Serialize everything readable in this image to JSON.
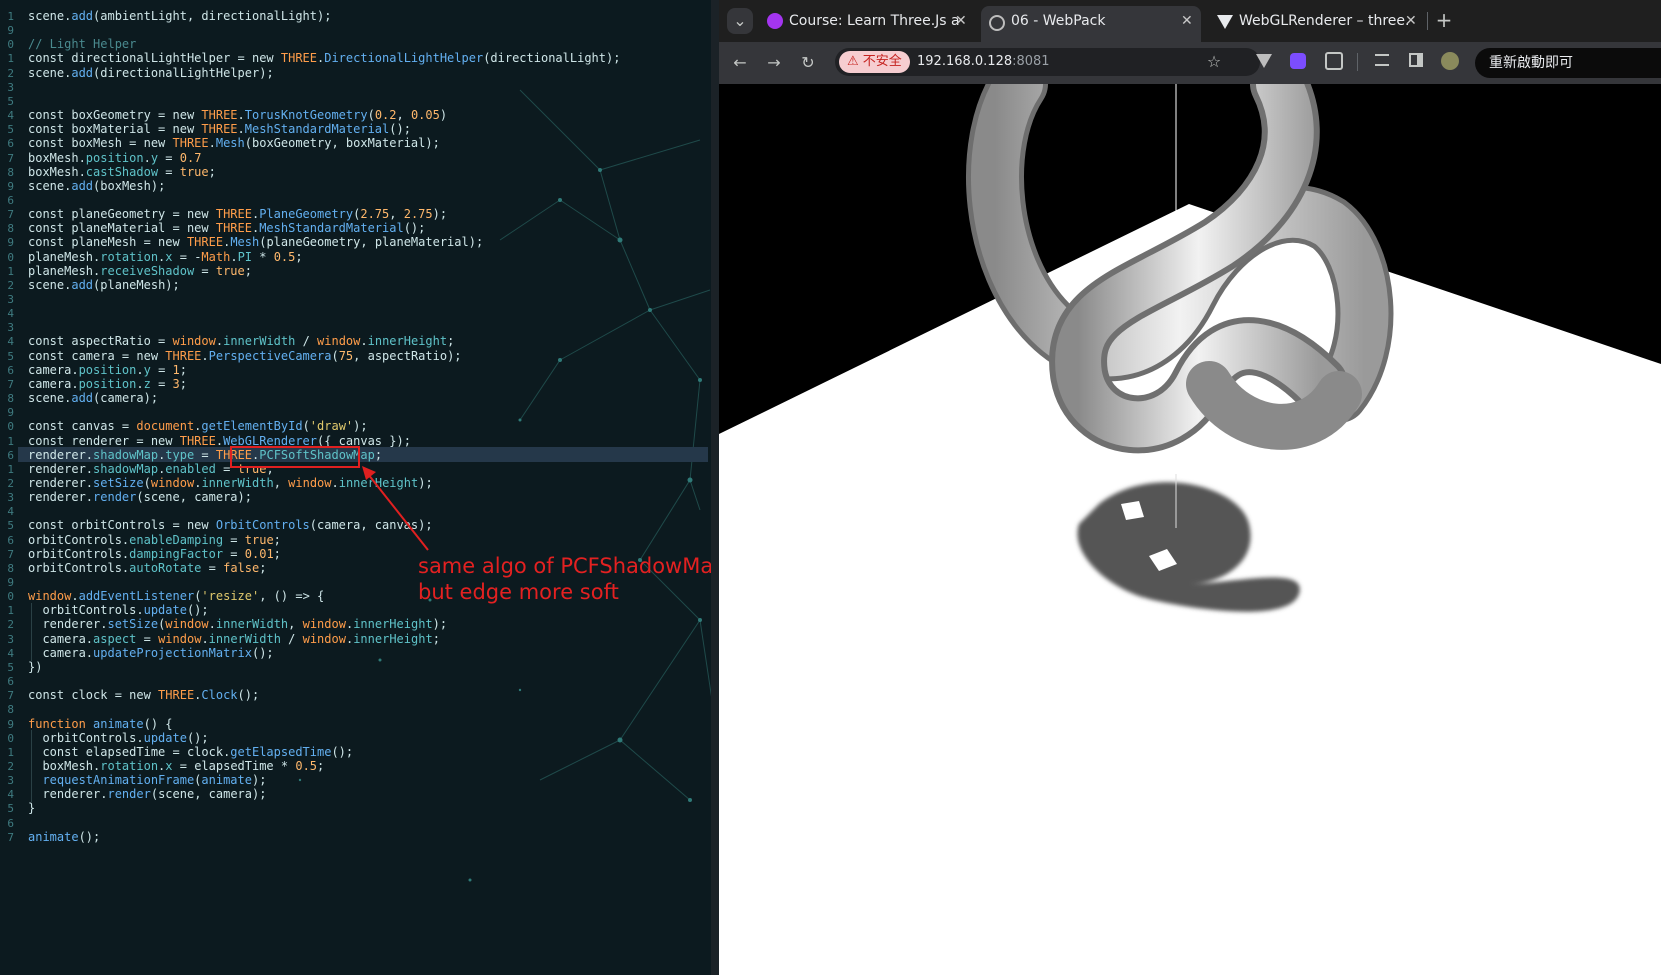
{
  "editor": {
    "lines": [
      {
        "num": "1",
        "html": "scene.<span class='f'>add</span>(ambientLight, directionalLight);"
      },
      {
        "num": "9",
        "html": ""
      },
      {
        "num": "0",
        "html": "<span class='c'>// Light Helper</span>"
      },
      {
        "num": "1",
        "html": "const directionalLightHelper = new <span class='t'>THREE</span>.<span class='f'>DirectionalLightHelper</span>(directionalLight);"
      },
      {
        "num": "2",
        "html": "scene.<span class='f'>add</span>(directionalLightHelper);"
      },
      {
        "num": "3",
        "html": ""
      },
      {
        "num": "5",
        "html": ""
      },
      {
        "num": "4",
        "html": "const boxGeometry = new <span class='t'>THREE</span>.<span class='f'>TorusKnotGeometry</span>(<span class='n'>0.2</span>, <span class='n'>0.05</span>)"
      },
      {
        "num": "5",
        "html": "const boxMaterial = new <span class='t'>THREE</span>.<span class='f'>MeshStandardMaterial</span>();"
      },
      {
        "num": "6",
        "html": "const boxMesh = new <span class='t'>THREE</span>.<span class='f'>Mesh</span>(boxGeometry, boxMaterial);"
      },
      {
        "num": "7",
        "html": "boxMesh.<span class='p'>position</span>.<span class='p'>y</span> = <span class='n'>0.7</span>"
      },
      {
        "num": "8",
        "html": "boxMesh.<span class='p'>castShadow</span> = <span class='n'>true</span>;"
      },
      {
        "num": "9",
        "html": "scene.<span class='f'>add</span>(boxMesh);"
      },
      {
        "num": "6",
        "html": ""
      },
      {
        "num": "7",
        "html": "const planeGeometry = new <span class='t'>THREE</span>.<span class='f'>PlaneGeometry</span>(<span class='n'>2.75</span>, <span class='n'>2.75</span>);"
      },
      {
        "num": "8",
        "html": "const planeMaterial = new <span class='t'>THREE</span>.<span class='f'>MeshStandardMaterial</span>();"
      },
      {
        "num": "9",
        "html": "const planeMesh = new <span class='t'>THREE</span>.<span class='f'>Mesh</span>(planeGeometry, planeMaterial);"
      },
      {
        "num": "0",
        "html": "planeMesh.<span class='p'>rotation</span>.<span class='p'>x</span> = -<span class='t'>Math</span>.<span class='p'>PI</span> * <span class='n'>0.5</span>;"
      },
      {
        "num": "1",
        "html": "planeMesh.<span class='p'>receiveShadow</span> = <span class='n'>true</span>;"
      },
      {
        "num": "2",
        "html": "scene.<span class='f'>add</span>(planeMesh);"
      },
      {
        "num": "3",
        "html": ""
      },
      {
        "num": "4",
        "html": ""
      },
      {
        "num": "3",
        "html": ""
      },
      {
        "num": "4",
        "html": "const aspectRatio = <span class='w'>window</span>.<span class='p'>innerWidth</span> / <span class='w'>window</span>.<span class='p'>innerHeight</span>;"
      },
      {
        "num": "5",
        "html": "const camera = new <span class='t'>THREE</span>.<span class='f'>PerspectiveCamera</span>(<span class='n'>75</span>, aspectRatio);"
      },
      {
        "num": "6",
        "html": "camera.<span class='p'>position</span>.<span class='p'>y</span> = <span class='n'>1</span>;"
      },
      {
        "num": "7",
        "html": "camera.<span class='p'>position</span>.<span class='p'>z</span> = <span class='n'>3</span>;"
      },
      {
        "num": "8",
        "html": "scene.<span class='f'>add</span>(camera);"
      },
      {
        "num": "9",
        "html": ""
      },
      {
        "num": "0",
        "html": "const canvas = <span class='w'>document</span>.<span class='f'>getElementById</span>(<span class='s'>'draw'</span>);"
      },
      {
        "num": "1",
        "html": "const renderer = new <span class='t'>THREE</span>.<span class='f'>WebGLRenderer</span>({ canvas });"
      },
      {
        "num": "6",
        "html": "renderer.<span class='p'>shadowMap</span>.<span class='p'>type</span> = <span class='t'>THREE</span>.<span class='p'>PCFSoftShadowMap</span>;"
      },
      {
        "num": "1",
        "html": "renderer.<span class='p'>shadowMap</span>.<span class='p'>enabled</span> = <span class='n'>true</span>;"
      },
      {
        "num": "2",
        "html": "renderer.<span class='f'>setSize</span>(<span class='w'>window</span>.<span class='p'>innerWidth</span>, <span class='w'>window</span>.<span class='p'>innerHeight</span>);"
      },
      {
        "num": "3",
        "html": "renderer.<span class='f'>render</span>(scene, camera);"
      },
      {
        "num": "4",
        "html": ""
      },
      {
        "num": "5",
        "html": "const orbitControls = new <span class='f'>OrbitControls</span>(camera, canvas);"
      },
      {
        "num": "6",
        "html": "orbitControls.<span class='p'>enableDamping</span> = <span class='n'>true</span>;"
      },
      {
        "num": "7",
        "html": "orbitControls.<span class='p'>dampingFactor</span> = <span class='n'>0.01</span>;"
      },
      {
        "num": "8",
        "html": "orbitControls.<span class='p'>autoRotate</span> = <span class='n'>false</span>;"
      },
      {
        "num": "9",
        "html": ""
      },
      {
        "num": "0",
        "html": "<span class='w'>window</span>.<span class='f'>addEventListener</span>(<span class='s'>'resize'</span>, () => {"
      },
      {
        "num": "1",
        "html": "  orbitControls.<span class='f'>update</span>();"
      },
      {
        "num": "2",
        "html": "  renderer.<span class='f'>setSize</span>(<span class='w'>window</span>.<span class='p'>innerWidth</span>, <span class='w'>window</span>.<span class='p'>innerHeight</span>);"
      },
      {
        "num": "3",
        "html": "  camera.<span class='p'>aspect</span> = <span class='w'>window</span>.<span class='p'>innerWidth</span> / <span class='w'>window</span>.<span class='p'>innerHeight</span>;"
      },
      {
        "num": "4",
        "html": "  camera.<span class='f'>updateProjectionMatrix</span>();"
      },
      {
        "num": "5",
        "html": "})"
      },
      {
        "num": "6",
        "html": ""
      },
      {
        "num": "7",
        "html": "const clock = new <span class='t'>THREE</span>.<span class='f'>Clock</span>();"
      },
      {
        "num": "8",
        "html": ""
      },
      {
        "num": "9",
        "html": "<span class='w'>function</span> <span class='f'>animate</span>() {"
      },
      {
        "num": "0",
        "html": "  orbitControls.<span class='f'>update</span>();"
      },
      {
        "num": "1",
        "html": "  const elapsedTime = clock.<span class='f'>getElapsedTime</span>();"
      },
      {
        "num": "2",
        "html": "  boxMesh.<span class='p'>rotation</span>.<span class='p'>x</span> = elapsedTime * <span class='n'>0.5</span>;"
      },
      {
        "num": "3",
        "html": "  <span class='f'>requestAnimationFrame</span>(<span class='f'>animate</span>);"
      },
      {
        "num": "4",
        "html": "  renderer.<span class='f'>render</span>(scene, camera);"
      },
      {
        "num": "5",
        "html": "}"
      },
      {
        "num": "6",
        "html": ""
      },
      {
        "num": "7",
        "html": "<span class='f'>animate</span>();"
      }
    ],
    "highlight_line_index": 31,
    "annotation": "same algo of PCFShadowMap\nbut edge more soft"
  },
  "browser": {
    "tabs": [
      {
        "title": "Course: Learn Three.Js a",
        "close": "✕",
        "active": false
      },
      {
        "title": "06 - WebPack",
        "close": "✕",
        "active": true
      },
      {
        "title": "WebGLRenderer – three.",
        "close": "✕",
        "active": false
      }
    ],
    "tab_search_icon": "⌄",
    "new_tab": "+",
    "back": "←",
    "forward": "→",
    "reload": "↻",
    "security_label": "⚠ 不安全",
    "url_host": "192.168.0.128",
    "url_port": ":8081",
    "bookmark": "☆",
    "relaunch_label": "重新啟動即可"
  },
  "colors": {
    "accent_red": "#e02020",
    "editor_bg": "#0c1a1f",
    "browser_chrome": "#35363a"
  }
}
